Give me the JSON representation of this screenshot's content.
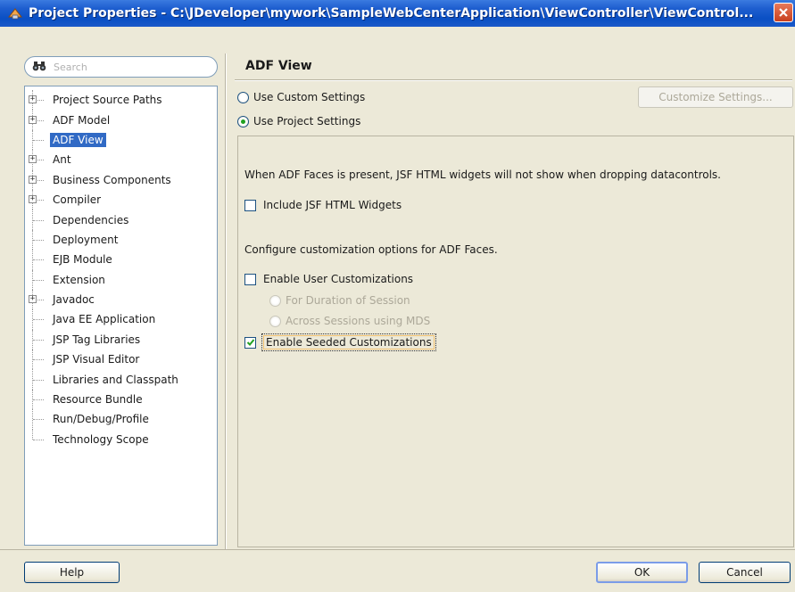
{
  "window": {
    "title": "Project Properties - C:\\JDeveloper\\mywork\\SampleWebCenterApplication\\ViewController\\ViewControl..."
  },
  "search": {
    "placeholder": "Search"
  },
  "tree": {
    "items": [
      {
        "label": "Project Source Paths",
        "expandable": true
      },
      {
        "label": "ADF Model",
        "expandable": true
      },
      {
        "label": "ADF View",
        "expandable": false,
        "selected": true
      },
      {
        "label": "Ant",
        "expandable": true
      },
      {
        "label": "Business Components",
        "expandable": true
      },
      {
        "label": "Compiler",
        "expandable": true
      },
      {
        "label": "Dependencies",
        "expandable": false
      },
      {
        "label": "Deployment",
        "expandable": false
      },
      {
        "label": "EJB Module",
        "expandable": false
      },
      {
        "label": "Extension",
        "expandable": false
      },
      {
        "label": "Javadoc",
        "expandable": true
      },
      {
        "label": "Java EE Application",
        "expandable": false
      },
      {
        "label": "JSP Tag Libraries",
        "expandable": false
      },
      {
        "label": "JSP Visual Editor",
        "expandable": false
      },
      {
        "label": "Libraries and Classpath",
        "expandable": false
      },
      {
        "label": "Resource Bundle",
        "expandable": false
      },
      {
        "label": "Run/Debug/Profile",
        "expandable": false
      },
      {
        "label": "Technology Scope",
        "expandable": false
      }
    ]
  },
  "panel": {
    "title": "ADF View",
    "use_custom_settings": "Use Custom Settings",
    "use_project_settings": "Use Project Settings",
    "customize_settings": "Customize Settings...",
    "adf_faces_note": "When ADF Faces is present, JSF HTML widgets will not show when dropping datacontrols.",
    "include_jsf_widgets": "Include JSF HTML Widgets",
    "configure_note": "Configure customization options for ADF Faces.",
    "enable_user_customizations": "Enable User Customizations",
    "for_duration_of_session": "For Duration of Session",
    "across_sessions_mds": "Across Sessions using MDS",
    "enable_seeded_customizations": "Enable Seeded Customizations",
    "states": {
      "use_project_settings_selected": true,
      "include_jsf_widgets_checked": false,
      "enable_user_customizations_checked": false,
      "enable_seeded_customizations_checked": true
    }
  },
  "footer": {
    "help": "Help",
    "ok": "OK",
    "cancel": "Cancel"
  },
  "colors": {
    "title_bar": "#0a4fc4",
    "selection": "#316ac5",
    "dialog_bg": "#ece9d8"
  }
}
